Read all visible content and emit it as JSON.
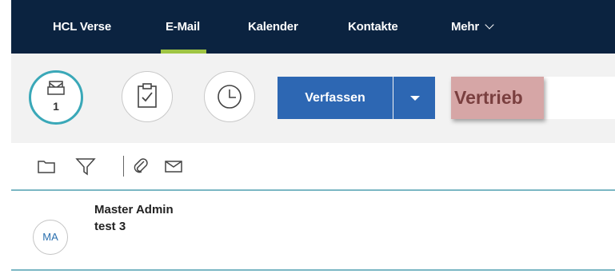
{
  "nav": {
    "items": [
      {
        "label": "HCL Verse"
      },
      {
        "label": "E-Mail"
      },
      {
        "label": "Kalender"
      },
      {
        "label": "Kontakte"
      },
      {
        "label": "Mehr"
      }
    ],
    "active": "E-Mail"
  },
  "toolbar": {
    "inbox_count": "1",
    "compose_label": "Verfassen",
    "folder_label": "Vertrieb"
  },
  "actions": {
    "icons": [
      "folder-icon",
      "filter-icon",
      "attachment-icon",
      "envelope-icon"
    ]
  },
  "mail_list": [
    {
      "avatar": "MA",
      "sender": "Master Admin",
      "subject": "test 3"
    }
  ],
  "colors": {
    "nav_bg": "#0b2340",
    "active_underline": "#9fc544",
    "compose_bg": "#2d67b3",
    "inbox_ring": "#3aa8b8",
    "folder_highlight": "#d6a6a6"
  }
}
